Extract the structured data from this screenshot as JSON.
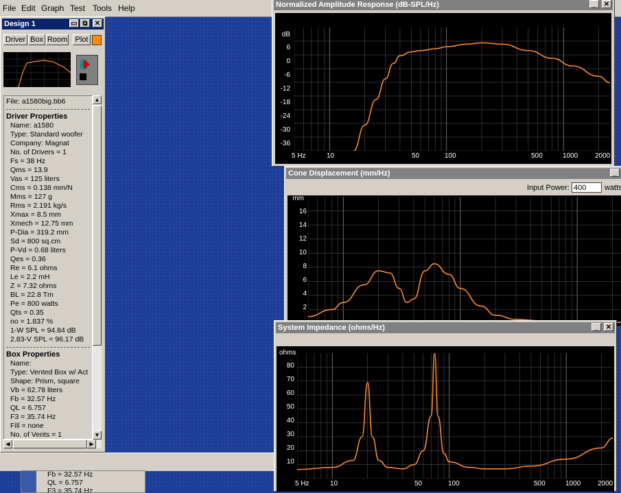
{
  "menu": [
    "File",
    "Edit",
    "Graph",
    "Test",
    "Tools",
    "Help"
  ],
  "design": {
    "title": "Design 1",
    "tabs": [
      "Driver",
      "Box",
      "Room",
      "Plot"
    ],
    "file": "File: a1580big.bb6",
    "driver_header": "Driver Properties",
    "driver": [
      "Name: a1580",
      "Type: Standard woofer",
      "Company: Magnat",
      "No. of Drivers = 1",
      "Fs = 38 Hz",
      "Qms = 13.9",
      "Vas = 125 liters",
      "Cms = 0.138 mm/N",
      "Mms = 127 g",
      "Rms = 2.191 kg/s",
      "Xmax = 8.5 mm",
      "Xmech = 12.75 mm",
      "P-Dia = 319.2 mm",
      "Sd = 800 sq.cm",
      "P-Vd = 0.68 liters",
      "Qes = 0.36",
      "Re = 6.1 ohms",
      "Le = 2.2 mH",
      "Z = 7.32 ohms",
      "BL = 22.8 Tm",
      "Pe = 800 watts",
      "Qts = 0.35",
      "no = 1.837 %",
      "1-W SPL = 94.84 dB",
      "2.83-V SPL = 96.17 dB"
    ],
    "box_header": "Box Properties",
    "box": [
      "Name:",
      "Type: Vented Box w/ Act",
      "Shape: Prism, square",
      "Vb = 62.78 liters",
      "Fb = 32.57 Hz",
      "QL = 6.757",
      "F3 = 35.74 Hz",
      "Fill = none",
      "No. of Vents = 1"
    ],
    "lower_box": [
      "Fb = 32.57 Hz",
      "QL = 6.757",
      "F3 = 35.74 Hz"
    ]
  },
  "colors": {
    "curve": "#ff8a2a",
    "grid": "#5a5a5a",
    "accent": "#ff8c00"
  },
  "amplitude": {
    "title": "Normalized Amplitude Response (dB-SPL/Hz)",
    "unit": "dB",
    "yticks": [
      "6",
      "0",
      "-6",
      "-12",
      "-18",
      "-24",
      "-30",
      "-36"
    ],
    "xticks": [
      "5 Hz",
      "10",
      "50",
      "100",
      "500",
      "1000",
      "2000"
    ]
  },
  "displacement": {
    "title": "Cone Displacement (mm/Hz)",
    "input_label": "Input Power:",
    "input_value": "400",
    "input_unit": "watts",
    "unit": "mm",
    "yticks": [
      "16",
      "14",
      "12",
      "10",
      "8",
      "6",
      "4",
      "2"
    ]
  },
  "impedance": {
    "title": "System Impedance (ohms/Hz)",
    "unit": "ohms",
    "yticks": [
      "80",
      "70",
      "60",
      "50",
      "40",
      "30",
      "20",
      "10"
    ],
    "xticks": [
      "5 Hz",
      "10",
      "50",
      "100",
      "500",
      "1000",
      "2000"
    ]
  },
  "chart_data": [
    {
      "type": "line",
      "title": "Normalized Amplitude Response (dB-SPL/Hz)",
      "ylabel": "dB",
      "xlim": [
        5,
        2500
      ],
      "ylim": [
        -40,
        8
      ],
      "x_scale": "log",
      "x": [
        16,
        20,
        25,
        30,
        35,
        40,
        50,
        60,
        80,
        100,
        150,
        200,
        300,
        500,
        800,
        1200,
        2000,
        2500
      ],
      "y": [
        -40,
        -30,
        -20,
        -12,
        -6,
        -3,
        -1.5,
        -1,
        -0.3,
        0.5,
        1.5,
        2,
        1.5,
        -1,
        -4,
        -7,
        -11,
        -13.5
      ]
    },
    {
      "type": "line",
      "title": "Cone Displacement (mm/Hz)",
      "ylabel": "mm",
      "xlim": [
        5,
        2500
      ],
      "ylim": [
        0,
        18
      ],
      "x_scale": "log",
      "x": [
        5,
        8,
        10,
        15,
        20,
        25,
        30,
        35,
        40,
        50,
        60,
        80,
        100,
        150,
        200,
        300,
        500,
        1000,
        2500
      ],
      "y": [
        1,
        2,
        3,
        5.5,
        7.5,
        7.2,
        5,
        3,
        3.5,
        7.5,
        8.5,
        7,
        5,
        2.5,
        1.2,
        0.6,
        0.4,
        0.3,
        0.2
      ]
    },
    {
      "type": "line",
      "title": "System Impedance (ohms/Hz)",
      "ylabel": "ohms",
      "xlim": [
        5,
        2500
      ],
      "ylim": [
        0,
        90
      ],
      "x_scale": "log",
      "x": [
        5,
        10,
        15,
        18,
        20,
        22,
        25,
        30,
        40,
        50,
        60,
        70,
        75,
        80,
        90,
        100,
        150,
        200,
        300,
        500,
        1000,
        2000,
        2500
      ],
      "y": [
        6.5,
        8,
        13,
        30,
        69,
        30,
        13,
        8,
        7,
        10,
        20,
        45,
        90,
        45,
        18,
        12,
        8,
        7,
        7,
        9,
        14,
        22,
        29
      ]
    }
  ]
}
